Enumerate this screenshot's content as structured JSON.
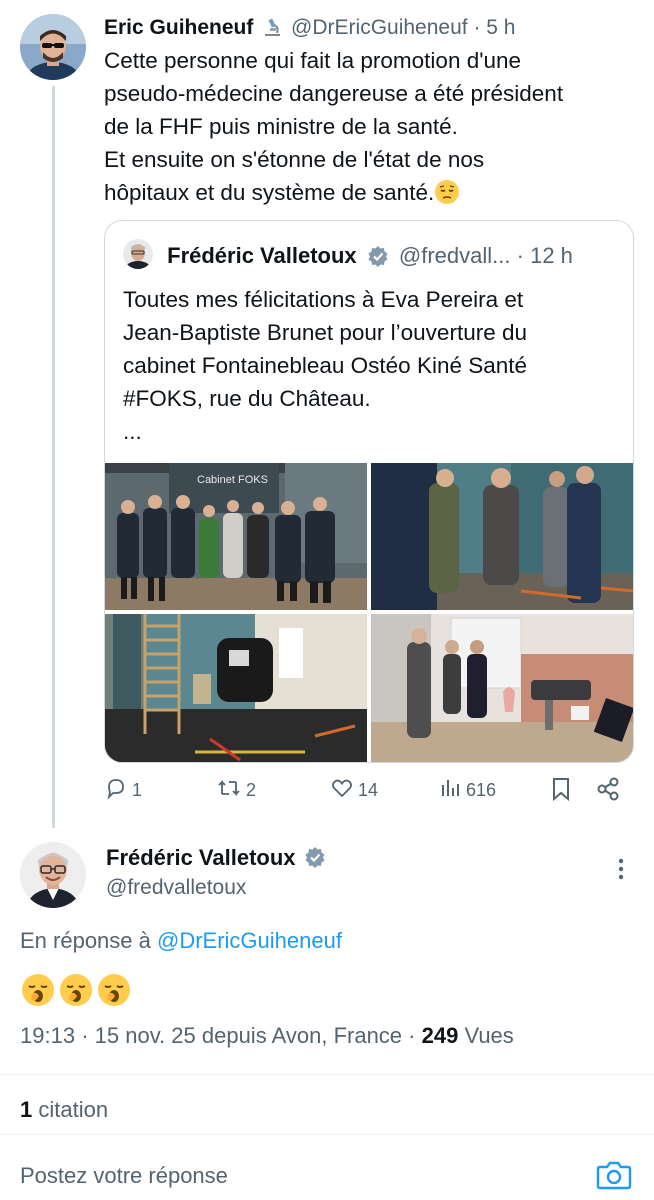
{
  "tweet1": {
    "name": "Eric Guiheneuf",
    "badge_icon": "microscope-icon",
    "handle": "@DrEricGuiheneuf",
    "separator": "·",
    "time": "5 h",
    "lines": [
      "Cette personne qui fait la promotion d'une",
      "pseudo-médecine dangereuse a été président",
      "de la FHF puis ministre de la santé.",
      "Et ensuite on s'étonne de l'état de nos",
      "hôpitaux et du système de santé."
    ],
    "emoji": "pensive-face"
  },
  "quote": {
    "name": "Frédéric Valletoux",
    "verified_icon": "verified-badge-icon",
    "handle": "@fredvall...",
    "separator": "·",
    "time": "12 h",
    "lines": [
      "Toutes mes félicitations à Eva Pereira et",
      "Jean-Baptiste Brunet pour l’ouverture du",
      "cabinet Fontainebleau Ostéo Kiné Santé",
      "#FOKS, rue du Château.",
      "..."
    ],
    "photo_sign": "Cabinet FOKS"
  },
  "actions": {
    "replies": "1",
    "reposts": "2",
    "likes": "14",
    "views": "616"
  },
  "tweet2": {
    "name": "Frédéric Valletoux",
    "verified_icon": "verified-badge-icon",
    "handle": "@fredvalletoux",
    "reply_prefix": "En réponse à",
    "reply_handle": "@DrEricGuiheneuf",
    "emojis": [
      "yawning-face",
      "yawning-face",
      "yawning-face"
    ],
    "time": "19:13",
    "sep1": "·",
    "date_location": "15 nov. 25 depuis Avon, France",
    "sep2": "·",
    "views_count": "249",
    "views_label": "Vues"
  },
  "stats": {
    "count": "1",
    "label": "citation"
  },
  "reply_box": {
    "placeholder": "Postez votre réponse"
  },
  "colors": {
    "link": "#1d9bf0",
    "muted": "#536471",
    "text": "#0f1419",
    "border": "#cfd9de"
  }
}
